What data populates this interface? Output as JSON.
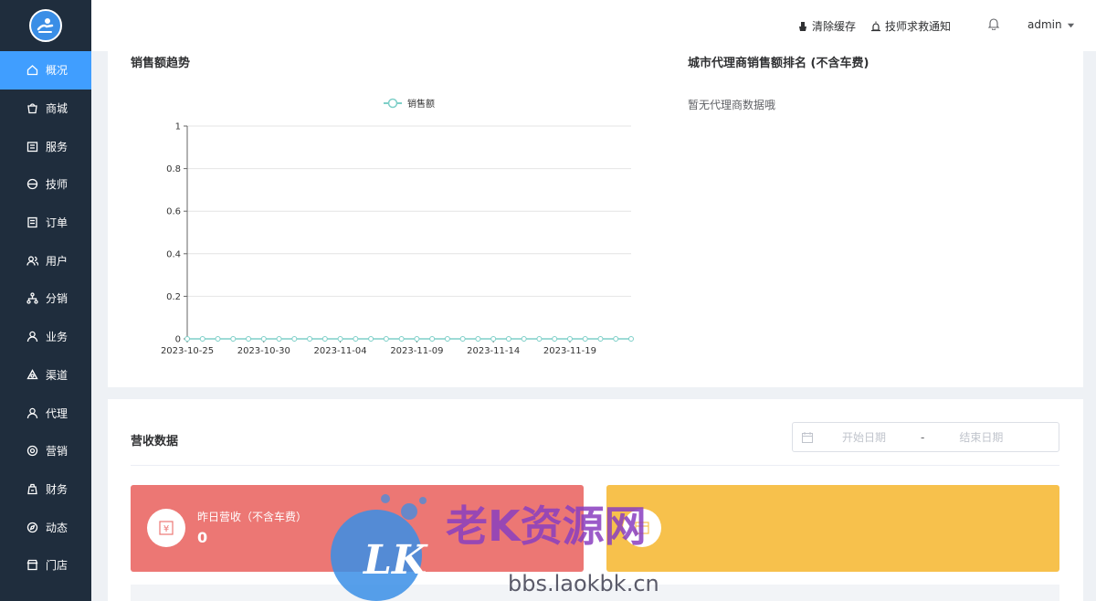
{
  "sidebar": {
    "items": [
      {
        "label": "概况",
        "icon": "home-icon",
        "active": true
      },
      {
        "label": "商城",
        "icon": "shop-icon"
      },
      {
        "label": "服务",
        "icon": "service-icon"
      },
      {
        "label": "技师",
        "icon": "technician-icon"
      },
      {
        "label": "订单",
        "icon": "order-icon"
      },
      {
        "label": "用户",
        "icon": "users-icon"
      },
      {
        "label": "分销",
        "icon": "distribution-icon"
      },
      {
        "label": "业务",
        "icon": "person-icon"
      },
      {
        "label": "渠道",
        "icon": "channel-icon"
      },
      {
        "label": "代理",
        "icon": "agent-icon"
      },
      {
        "label": "营销",
        "icon": "marketing-icon"
      },
      {
        "label": "财务",
        "icon": "finance-icon"
      },
      {
        "label": "动态",
        "icon": "compass-icon"
      },
      {
        "label": "门店",
        "icon": "store-icon"
      }
    ]
  },
  "header": {
    "clear_cache": "清除缓存",
    "rescue_notice": "技师求救通知",
    "user": "admin"
  },
  "sales_trend": {
    "title": "销售额趋势"
  },
  "ranking": {
    "title": "城市代理商销售额排名 (不含车费)",
    "empty_text": "暂无代理商数据哦"
  },
  "chart_data": {
    "type": "line",
    "legend": [
      "销售额"
    ],
    "legend_position": "top-center",
    "x_tick_labels": [
      "2023-10-25",
      "2023-10-30",
      "2023-11-04",
      "2023-11-09",
      "2023-11-14",
      "2023-11-19"
    ],
    "y_tick_labels": [
      "0",
      "0.2",
      "0.4",
      "0.6",
      "0.8",
      "1"
    ],
    "ylim": [
      0,
      1
    ],
    "grid": true,
    "series": [
      {
        "name": "销售额",
        "color": "#7ecfc8",
        "x": [
          "2023-10-25",
          "2023-10-26",
          "2023-10-27",
          "2023-10-28",
          "2023-10-29",
          "2023-10-30",
          "2023-10-31",
          "2023-11-01",
          "2023-11-02",
          "2023-11-03",
          "2023-11-04",
          "2023-11-05",
          "2023-11-06",
          "2023-11-07",
          "2023-11-08",
          "2023-11-09",
          "2023-11-10",
          "2023-11-11",
          "2023-11-12",
          "2023-11-13",
          "2023-11-14",
          "2023-11-15",
          "2023-11-16",
          "2023-11-17",
          "2023-11-18",
          "2023-11-19",
          "2023-11-20",
          "2023-11-21",
          "2023-11-22",
          "2023-11-23"
        ],
        "values": [
          0,
          0,
          0,
          0,
          0,
          0,
          0,
          0,
          0,
          0,
          0,
          0,
          0,
          0,
          0,
          0,
          0,
          0,
          0,
          0,
          0,
          0,
          0,
          0,
          0,
          0,
          0,
          0,
          0,
          0
        ]
      }
    ]
  },
  "revenue": {
    "title": "营收数据",
    "start_placeholder": "开始日期",
    "separator": "-",
    "end_placeholder": "结束日期",
    "yesterday_label": "昨日营收（不含车费）",
    "yesterday_value": "0",
    "colors": {
      "red_card": "#ec7774",
      "yellow_card": "#f7c14c"
    }
  },
  "watermark": {
    "logo_text": "LK",
    "text": "老K资源网",
    "url": "bbs.laokbk.cn"
  }
}
